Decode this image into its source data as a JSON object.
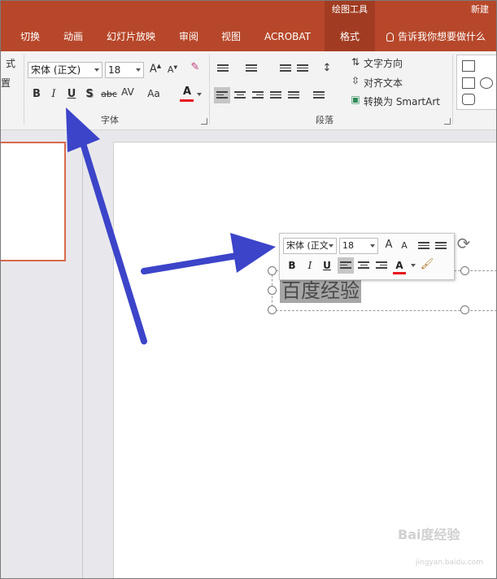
{
  "titlebar": {
    "context_header": "绘图工具",
    "right_title": "新建"
  },
  "tabs": [
    {
      "label": "切换"
    },
    {
      "label": "动画"
    },
    {
      "label": "幻灯片放映"
    },
    {
      "label": "审阅"
    },
    {
      "label": "视图"
    },
    {
      "label": "ACROBAT"
    },
    {
      "label": "格式",
      "active": true
    }
  ],
  "tell_me": "告诉我你想要做什么",
  "left_partial": {
    "item1": "式",
    "item2": "置"
  },
  "font_group": {
    "label": "字体",
    "font_name": "宋体 (正文)",
    "font_size": "18",
    "bold": "B",
    "italic": "I",
    "underline": "U",
    "shadow": "S",
    "strike": "abc",
    "spacing": "AV",
    "case": "Aa",
    "font_color": "A"
  },
  "paragraph_group": {
    "label": "段落",
    "text_direction": "文字方向",
    "align_text": "对齐文本",
    "convert_smartart": "转换为 SmartArt"
  },
  "slide": {
    "selected_text": "百度经验"
  },
  "mini_toolbar": {
    "font_name": "宋体 (正文",
    "font_size": "18",
    "bold": "B",
    "italic": "I",
    "underline": "U",
    "font_color": "A"
  },
  "watermark": {
    "brand": "Bai度经验",
    "url": "jingyan.baidu.com"
  },
  "colors": {
    "ribbon": "#b7472a",
    "active_tab": "#a13c22",
    "arrow": "#3c44c9",
    "font_color_bar": "#e8141e"
  }
}
